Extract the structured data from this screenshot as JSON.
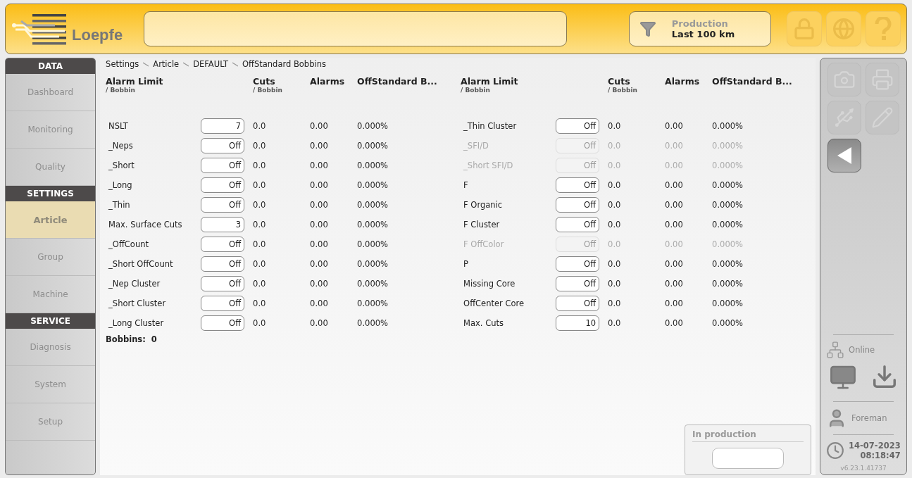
{
  "header": {
    "logo": "Loepfe",
    "filter": {
      "title": "Production",
      "value": "Last 100 km"
    },
    "buttons": [
      {
        "kind": "lock",
        "disabled": true
      },
      {
        "kind": "globe",
        "disabled": true
      },
      {
        "kind": "help",
        "disabled": true
      }
    ]
  },
  "sidebar": [
    {
      "title": "DATA",
      "items": [
        {
          "label": "Dashboard",
          "selected": false
        },
        {
          "label": "Monitoring",
          "selected": false
        },
        {
          "label": "Quality",
          "selected": false
        }
      ]
    },
    {
      "title": "SETTINGS",
      "items": [
        {
          "label": "Article",
          "selected": true
        },
        {
          "label": "Group",
          "selected": false
        },
        {
          "label": "Machine",
          "selected": false
        }
      ]
    },
    {
      "title": "SERVICE",
      "items": [
        {
          "label": "Diagnosis",
          "selected": false
        },
        {
          "label": "System",
          "selected": false
        },
        {
          "label": "Setup",
          "selected": false
        }
      ]
    }
  ],
  "breadcrumb": [
    "Settings",
    "Article",
    "DEFAULT",
    "OffStandard Bobbins"
  ],
  "tables": [
    {
      "columns": [
        {
          "title": "Alarm Limit",
          "sub": "/ Bobbin"
        },
        {
          "title": "Cuts",
          "sub": "/ Bobbin"
        },
        {
          "title": "Alarms"
        },
        {
          "title": "OffStandard B..."
        }
      ],
      "rows": [
        {
          "label": "NSLT",
          "value": "7",
          "cuts": "0.0",
          "alarms": "0.00",
          "offstandard": "0.000%",
          "disabled": false
        },
        {
          "label": "_Neps",
          "value": "Off",
          "cuts": "0.0",
          "alarms": "0.00",
          "offstandard": "0.000%",
          "disabled": false
        },
        {
          "label": "_Short",
          "value": "Off",
          "cuts": "0.0",
          "alarms": "0.00",
          "offstandard": "0.000%",
          "disabled": false
        },
        {
          "label": "_Long",
          "value": "Off",
          "cuts": "0.0",
          "alarms": "0.00",
          "offstandard": "0.000%",
          "disabled": false
        },
        {
          "label": "_Thin",
          "value": "Off",
          "cuts": "0.0",
          "alarms": "0.00",
          "offstandard": "0.000%",
          "disabled": false
        },
        {
          "label": "Max. Surface Cuts",
          "value": "3",
          "cuts": "0.0",
          "alarms": "0.00",
          "offstandard": "0.000%",
          "disabled": false
        },
        {
          "label": "_OffCount",
          "value": "Off",
          "cuts": "0.0",
          "alarms": "0.00",
          "offstandard": "0.000%",
          "disabled": false
        },
        {
          "label": "_Short OffCount",
          "value": "Off",
          "cuts": "0.0",
          "alarms": "0.00",
          "offstandard": "0.000%",
          "disabled": false
        },
        {
          "label": "_Nep Cluster",
          "value": "Off",
          "cuts": "0.0",
          "alarms": "0.00",
          "offstandard": "0.000%",
          "disabled": false
        },
        {
          "label": "_Short Cluster",
          "value": "Off",
          "cuts": "0.0",
          "alarms": "0.00",
          "offstandard": "0.000%",
          "disabled": false
        },
        {
          "label": "_Long Cluster",
          "value": "Off",
          "cuts": "0.0",
          "alarms": "0.00",
          "offstandard": "0.000%",
          "disabled": false
        }
      ]
    },
    {
      "columns": [
        {
          "title": "Alarm Limit",
          "sub": "/ Bobbin"
        },
        {
          "title": "Cuts",
          "sub": "/ Bobbin"
        },
        {
          "title": "Alarms"
        },
        {
          "title": "OffStandard B..."
        }
      ],
      "rows": [
        {
          "label": "_Thin Cluster",
          "value": "Off",
          "cuts": "0.0",
          "alarms": "0.00",
          "offstandard": "0.000%",
          "disabled": false
        },
        {
          "label": "_SFI/D",
          "value": "Off",
          "cuts": "0.0",
          "alarms": "0.00",
          "offstandard": "0.000%",
          "disabled": true
        },
        {
          "label": "_Short SFI/D",
          "value": "Off",
          "cuts": "0.0",
          "alarms": "0.00",
          "offstandard": "0.000%",
          "disabled": true
        },
        {
          "label": "F",
          "value": "Off",
          "cuts": "0.0",
          "alarms": "0.00",
          "offstandard": "0.000%",
          "disabled": false
        },
        {
          "label": "F Organic",
          "value": "Off",
          "cuts": "0.0",
          "alarms": "0.00",
          "offstandard": "0.000%",
          "disabled": false
        },
        {
          "label": "F Cluster",
          "value": "Off",
          "cuts": "0.0",
          "alarms": "0.00",
          "offstandard": "0.000%",
          "disabled": false
        },
        {
          "label": "F OffColor",
          "value": "Off",
          "cuts": "0.0",
          "alarms": "0.00",
          "offstandard": "0.000%",
          "disabled": true
        },
        {
          "label": "P",
          "value": "Off",
          "cuts": "0.0",
          "alarms": "0.00",
          "offstandard": "0.000%",
          "disabled": false
        },
        {
          "label": "Missing Core",
          "value": "Off",
          "cuts": "0.0",
          "alarms": "0.00",
          "offstandard": "0.000%",
          "disabled": false
        },
        {
          "label": "OffCenter Core",
          "value": "Off",
          "cuts": "0.0",
          "alarms": "0.00",
          "offstandard": "0.000%",
          "disabled": false
        },
        {
          "label": "Max. Cuts",
          "value": "10",
          "cuts": "0.0",
          "alarms": "0.00",
          "offstandard": "0.000%",
          "disabled": false
        }
      ]
    }
  ],
  "bobbins": {
    "label": "Bobbins:",
    "value": "0"
  },
  "production_box": {
    "title": "In production"
  },
  "toolbar": [
    {
      "kind": "camera",
      "disabled": true
    },
    {
      "kind": "printer",
      "disabled": true
    },
    {
      "kind": "usb",
      "disabled": true
    },
    {
      "kind": "pencil",
      "disabled": true
    },
    {
      "kind": "back",
      "disabled": false
    }
  ],
  "status": {
    "connection": "Online",
    "user": "Foreman",
    "date": "14-07-2023",
    "time": "08:18:47",
    "version": "v6.23.1.41737"
  }
}
